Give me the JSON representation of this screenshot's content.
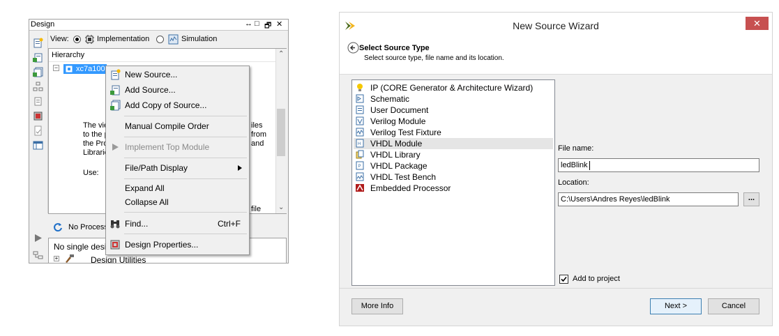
{
  "design_panel": {
    "title": "Design",
    "title_controls": [
      "↔",
      "□",
      "🗗",
      "✕"
    ],
    "view_label": "View:",
    "view_options": [
      {
        "label": "Implementation",
        "selected": true
      },
      {
        "label": "Simulation",
        "selected": false
      }
    ],
    "hierarchy_label": "Hierarchy",
    "tree_selected_item": "xc7a100",
    "partial_text": {
      "line1": "The vie",
      "line2": "to the p",
      "line3": "the Pro",
      "line4": "Librarie",
      "use": "Use:",
      "right1": "iles",
      "right2": "from",
      "right3": "and",
      "right4": "file"
    },
    "processes_label": "No Process",
    "bottom_line1": "No single desi",
    "bottom_line2": "Design Utilities"
  },
  "context_menu": {
    "items": [
      {
        "label": "New Source...",
        "icon": "new-source-icon",
        "enabled": true
      },
      {
        "label": "Add Source...",
        "icon": "add-source-icon",
        "enabled": true
      },
      {
        "label": "Add Copy of Source...",
        "icon": "add-copy-source-icon",
        "enabled": true
      },
      {
        "label": "Manual Compile Order",
        "enabled": true
      },
      {
        "label": "Implement Top Module",
        "icon": "play-icon",
        "enabled": false
      },
      {
        "label": "File/Path Display",
        "submenu": true,
        "enabled": true
      },
      {
        "label": "Expand All",
        "enabled": true
      },
      {
        "label": "Collapse All",
        "enabled": true
      },
      {
        "label": "Find...",
        "shortcut": "Ctrl+F",
        "icon": "binoculars-icon",
        "enabled": true
      },
      {
        "label": "Design Properties...",
        "icon": "design-properties-icon",
        "enabled": true
      }
    ]
  },
  "wizard": {
    "title": "New Source Wizard",
    "close_glyph": "✕",
    "section_title": "Select Source Type",
    "section_subtitle": "Select source type, file name and its location.",
    "source_types": [
      {
        "label": "IP (CORE Generator & Architecture Wizard)",
        "icon": "ip-core-icon"
      },
      {
        "label": "Schematic",
        "icon": "schematic-icon"
      },
      {
        "label": "User Document",
        "icon": "user-document-icon"
      },
      {
        "label": "Verilog Module",
        "icon": "verilog-module-icon"
      },
      {
        "label": "Verilog Test Fixture",
        "icon": "verilog-test-fixture-icon"
      },
      {
        "label": "VHDL Module",
        "icon": "vhdl-module-icon",
        "selected": true
      },
      {
        "label": "VHDL Library",
        "icon": "vhdl-library-icon"
      },
      {
        "label": "VHDL Package",
        "icon": "vhdl-package-icon"
      },
      {
        "label": "VHDL Test Bench",
        "icon": "vhdl-test-bench-icon"
      },
      {
        "label": "Embedded Processor",
        "icon": "embedded-processor-icon"
      }
    ],
    "file_name_label": "File name:",
    "file_name_value": "ledBlink",
    "location_label": "Location:",
    "location_value": "C:\\Users\\Andres Reyes\\ledBlink",
    "browse_label": "...",
    "add_to_project_label": "Add to project",
    "add_to_project_checked": true,
    "more_info_label": "More Info",
    "next_label": "Next >",
    "cancel_label": "Cancel"
  }
}
